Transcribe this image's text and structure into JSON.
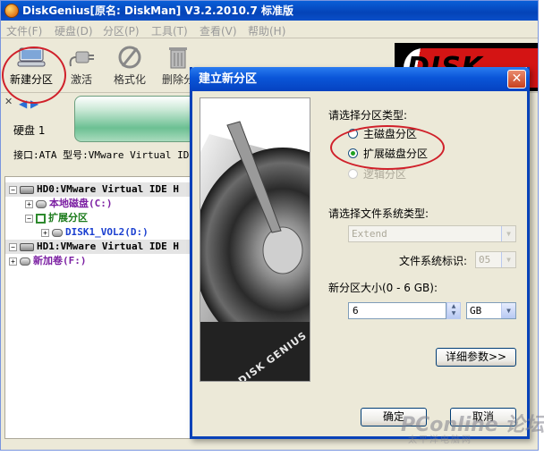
{
  "window": {
    "title": "DiskGenius[原名: DiskMan] V3.2.2010.7 标准版"
  },
  "menu": [
    "文件(F)",
    "硬盘(D)",
    "分区(P)",
    "工具(T)",
    "查看(V)",
    "帮助(H)"
  ],
  "toolbar": {
    "buttons": [
      {
        "label": "新建分区",
        "icon": "new-partition-icon"
      },
      {
        "label": "激活",
        "icon": "plug-icon"
      },
      {
        "label": "格式化",
        "icon": "format-icon"
      },
      {
        "label": "删除分",
        "icon": "trash-icon"
      }
    ]
  },
  "brand": {
    "text": "DISK"
  },
  "disk_strip": {
    "disk_label": "硬盘 1",
    "interface_label": "接口:ATA  型号:VMware Virtual IDE"
  },
  "tree": {
    "hd0": "HD0:VMware Virtual IDE H",
    "local_disk": "本地磁盘(C:)",
    "extended": "扩展分区",
    "vol": "DISK1_VOL2(D:)",
    "hd1": "HD1:VMware Virtual IDE H",
    "new_volume": "新加卷(F:)"
  },
  "dialog": {
    "title": "建立新分区",
    "close_symbol": "✕",
    "partition_type_label": "请选择分区类型:",
    "radio_primary": "主磁盘分区",
    "radio_extended": "扩展磁盘分区",
    "radio_logical": "逻辑分区",
    "fs_type_label": "请选择文件系统类型:",
    "fs_type_value": "Extend",
    "fs_id_label": "文件系统标识:",
    "fs_id_value": "05",
    "size_label": "新分区大小(0 - 6 GB):",
    "size_value": "6",
    "size_unit": "GB",
    "details_button": "详细参数>>",
    "ok_button": "确定",
    "cancel_button": "取消",
    "logo_text": "DISK GENIUS"
  },
  "watermark": {
    "text": "PConline 论坛",
    "sub": "太平洋电脑网"
  }
}
